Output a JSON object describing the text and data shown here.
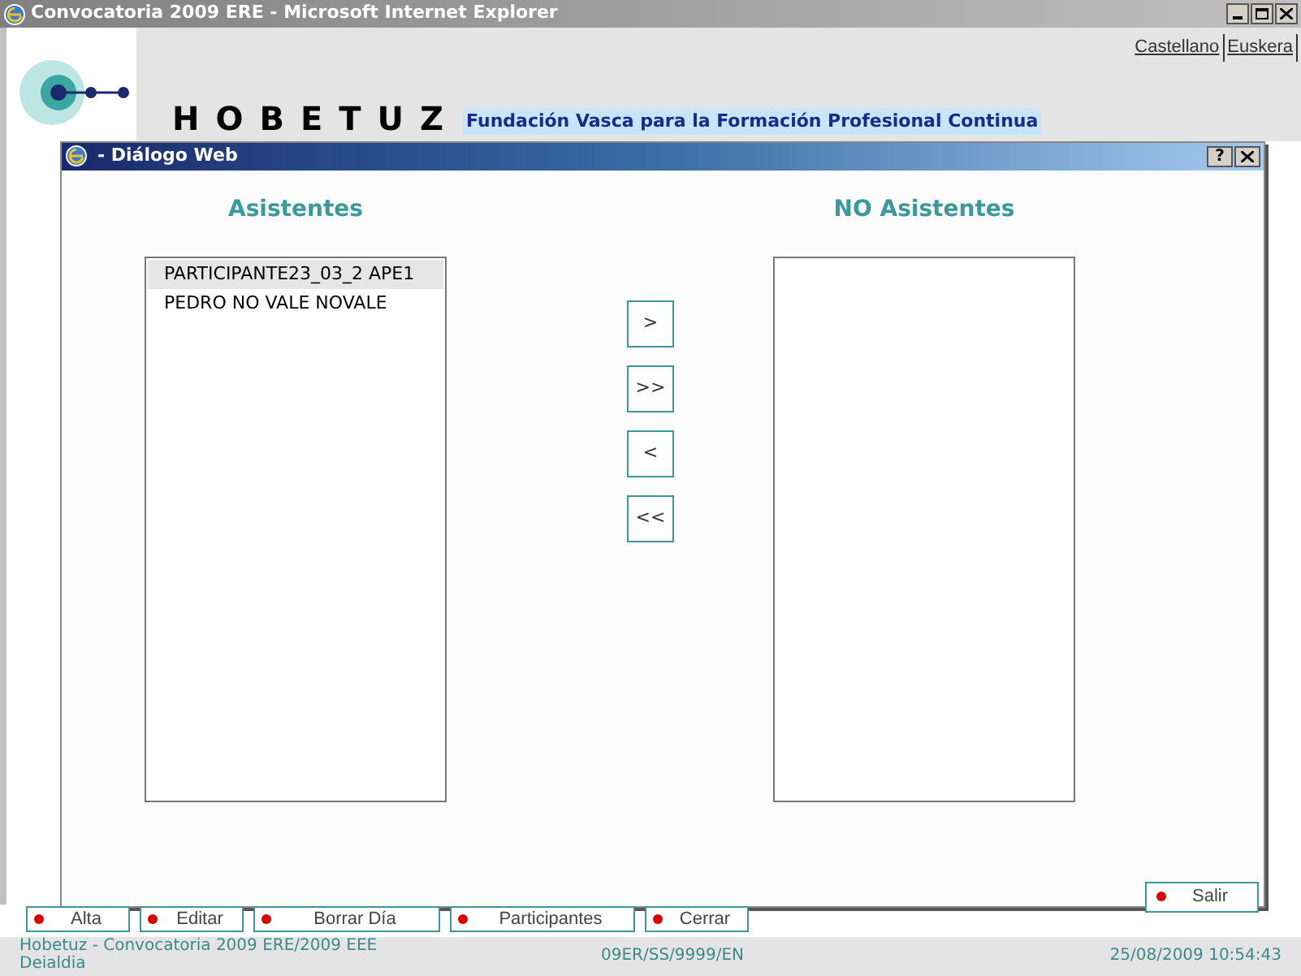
{
  "window": {
    "title": "Convocatoria 2009 ERE - Microsoft Internet Explorer"
  },
  "header": {
    "languages": [
      "Castellano",
      "Euskera"
    ],
    "logo_text": "HOBETUZ",
    "tagline": "Fundación Vasca para la Formación Profesional Continua"
  },
  "dialog": {
    "title": "- Diálogo Web",
    "left_list": {
      "heading": "Asistentes",
      "items": [
        {
          "label": "PARTICIPANTE23_03_2 APE1",
          "selected": true
        },
        {
          "label": "PEDRO NO VALE NOVALE",
          "selected": false
        }
      ]
    },
    "move_buttons": [
      ">",
      ">>",
      "<",
      "<<"
    ],
    "right_list": {
      "heading": "NO Asistentes"
    },
    "help_button": "?",
    "exit_button": "Salir"
  },
  "toolbar": [
    "Alta",
    "Editar",
    "Borrar Día",
    "Participantes",
    "Cerrar"
  ],
  "status_bar": {
    "left": "Hobetuz - Convocatoria 2009 ERE/2009 EEE Deialdia",
    "center": "09ER/SS/9999/EN",
    "right": "25/08/2009 10:54:43"
  }
}
